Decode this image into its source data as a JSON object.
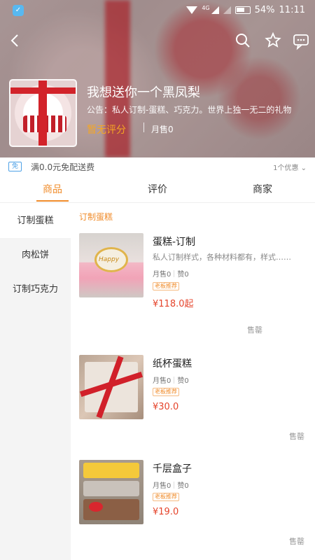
{
  "status_bar": {
    "battery": "54%",
    "time": "11:11",
    "network": "4G"
  },
  "header": {
    "shop_name": "我想送你一个黑凤梨",
    "notice": "公告：私人订制-蛋糕、巧克力。世界上独一无二的礼物",
    "rating": "暂无评分",
    "monthly_sales": "月售0"
  },
  "promo": {
    "badge": "免",
    "text": "满0.0元免配送费",
    "right": "1个优惠 ⌄"
  },
  "tabs": [
    "商品",
    "评价",
    "商家"
  ],
  "sidebar": {
    "items": [
      "订制蛋糕",
      "肉松饼",
      "订制巧克力"
    ]
  },
  "section_title": "订制蛋糕",
  "items": [
    {
      "name": "蛋糕-订制",
      "desc": "私人订制样式，各种材料都有，样式……",
      "sales": "月售0",
      "likes": "赞0",
      "tag": "老板推荐",
      "price": "¥118.0起",
      "sold_out": "售罄"
    },
    {
      "name": "纸杯蛋糕",
      "desc": "",
      "sales": "月售0",
      "likes": "赞0",
      "tag": "老板推荐",
      "price": "¥30.0",
      "sold_out": "售罄"
    },
    {
      "name": "千层盒子",
      "desc": "",
      "sales": "月售0",
      "likes": "赞0",
      "tag": "老板推荐",
      "price": "¥19.0",
      "sold_out": "售罄"
    }
  ],
  "colors": {
    "accent": "#f08c2b",
    "price": "#e5442b",
    "promo_badge": "#4ea1e6"
  }
}
